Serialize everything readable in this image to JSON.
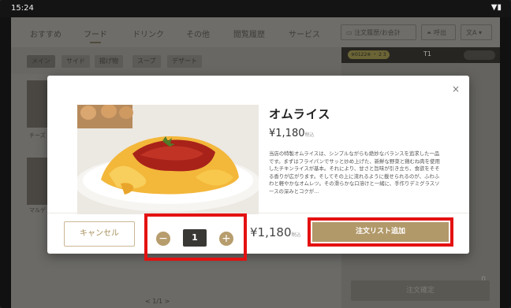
{
  "status_bar": {
    "time": "15:24",
    "icons": "▼▮"
  },
  "nav": {
    "tabs": [
      "おすすめ",
      "フード",
      "ドリンク",
      "その他",
      "閲覧履歴",
      "サービス"
    ],
    "history_button": "注文履歴/お会計",
    "call_button": "呼出",
    "lang_button": "文A"
  },
  "subnav": {
    "chips": [
      "メイン",
      "サイド",
      "揚げ物",
      "スープ",
      "デザート"
    ]
  },
  "right_panel": {
    "badge": "※0122※ ・ 2 3",
    "table": "T1",
    "zero": "0",
    "confirm": "注文確定"
  },
  "thumbs": [
    "チーズ",
    "マルゲ"
  ],
  "pager": "< 1/1 >",
  "modal": {
    "close": "×",
    "title": "オムライス",
    "price": "¥1,180",
    "tax_mark": "税込",
    "description": "当店の特製オムライスは、シンプルながらも絶妙なバランスを追求した一品です。まずはフライパンでサッと炒め上げた、新鮮な野菜と鶏むね肉を使用したチキンライスが基本。それにより、甘さと旨味が引き立ち、食欲をそそる香りが広がります。そしてその上に流れるように載せられるのが、ふわふわと軽やかなオムレツ。その滑らかな口溶けと一緒に、手作りデミグラスソースの深みとコクが…",
    "cancel": "キャンセル",
    "minus": "−",
    "quantity": "1",
    "plus": "+",
    "total": "¥1,180",
    "add_button": "注文リスト追加"
  }
}
